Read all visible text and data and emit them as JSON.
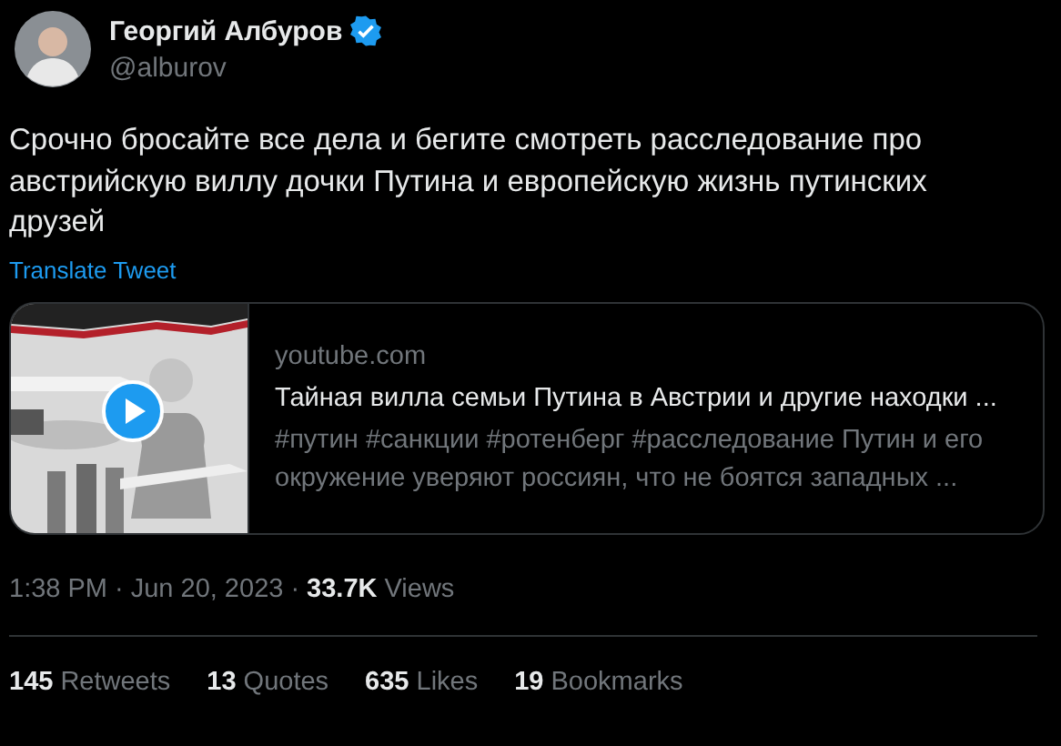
{
  "author": {
    "name": "Георгий Албуров",
    "verified": true,
    "handle": "@alburov"
  },
  "tweet": {
    "text": "Срочно бросайте все дела и бегите смотреть расследование про австрийскую виллу дочки Путина и европейскую жизнь путинских друзей",
    "translate": "Translate Tweet"
  },
  "card": {
    "thumbnail": {
      "kind": "picture",
      "has_video": true
    },
    "domain": "youtube.com",
    "title": "Тайная вилла семьи Путина в Австрии и другие находки ...",
    "description": "#путин #санкции #ротенберг #расследование Путин и его окружение уверяют россиян, что не боятся западных ..."
  },
  "meta": {
    "time": "1:38 PM",
    "date": "Jun 20, 2023",
    "views_count": "33.7K",
    "views_label": "Views",
    "separators": [
      "·",
      "·"
    ]
  },
  "stats": [
    {
      "count": "145",
      "label": "Retweets"
    },
    {
      "count": "13",
      "label": "Quotes"
    },
    {
      "count": "635",
      "label": "Likes"
    },
    {
      "count": "19",
      "label": "Bookmarks"
    }
  ]
}
